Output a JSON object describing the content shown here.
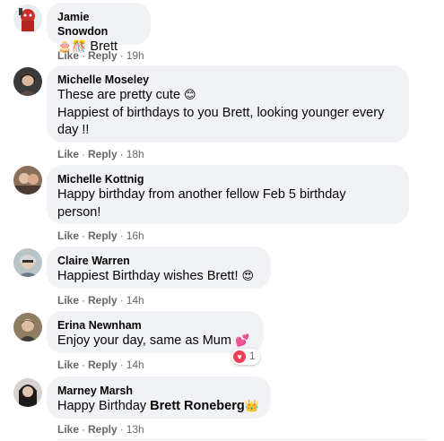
{
  "comments": [
    {
      "name": "Jamie Snowdon",
      "text": "Brett",
      "emoji_prefix": "🎂🎊",
      "like": "Like",
      "reply": "Reply",
      "time": "19h",
      "avatar_icon": "red-figure-avatar-icon"
    },
    {
      "name": "Michelle Moseley",
      "line1": "These are pretty cute",
      "line1_emoji": "😊",
      "line2": "Happiest of birthdays to you Brett, looking younger every",
      "line3": "day !!",
      "like": "Like",
      "reply": "Reply",
      "time": "18h"
    },
    {
      "name": "Michelle Kottnig",
      "line1": "Happy birthday from another fellow Feb 5 birthday",
      "line2": "person!",
      "like": "Like",
      "reply": "Reply",
      "time": "16h"
    },
    {
      "name": "Claire Warren",
      "text": "Happiest Birthday wishes Brett!",
      "emoji": "😍",
      "like": "Like",
      "reply": "Reply",
      "time": "14h"
    },
    {
      "name": "Erina Newnham",
      "text": "Enjoy your day, same as Mum",
      "emoji": "💕",
      "like": "Like",
      "reply": "Reply",
      "time": "14h",
      "reaction_count": "1"
    },
    {
      "name": "Marney Marsh",
      "text_prefix": "Happy Birthday",
      "mention": "Brett Roneberg",
      "emoji": "👑",
      "like": "Like",
      "reply": "Reply",
      "time": "13h"
    }
  ],
  "separator": "·",
  "colors": {
    "bubble": "#f0f2f5",
    "meta_text": "#65676b",
    "love_reaction": "#f33e58"
  }
}
